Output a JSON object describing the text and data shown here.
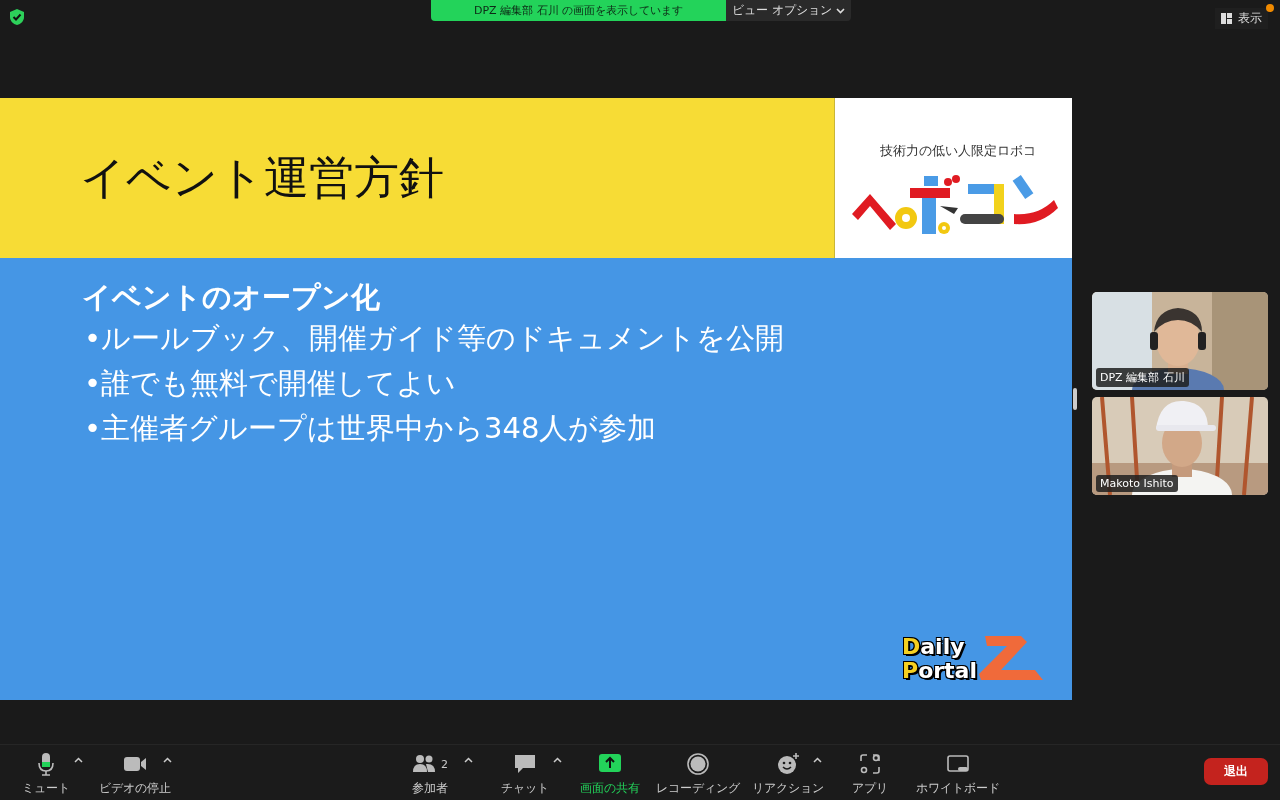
{
  "top_bar": {
    "share_banner": "DPZ 編集部 石川 の画面を表示しています",
    "view_options": "ビュー オプション",
    "view_button": "表示"
  },
  "slide": {
    "title": "イベント運営方針",
    "logo_caption": "技術力の低い人限定ロボコ",
    "heading": "イベントのオープン化",
    "bullets": [
      "•ルールブック、開催ガイド等のドキュメントを公開",
      "•誰でも無料で開催してよい",
      "•主催者グループは世界中から348人が参加"
    ],
    "brand": [
      "Daily",
      "Portal"
    ]
  },
  "videos": [
    {
      "name": "DPZ 編集部 石川",
      "kind": "picture"
    },
    {
      "name": "Makoto Ishito",
      "kind": "picture"
    }
  ],
  "toolbar": {
    "items": [
      {
        "kind": "mic",
        "label": "ミュート",
        "caret": true,
        "active": false
      },
      {
        "kind": "camera",
        "label": "ビデオの停止",
        "caret": true,
        "active": false
      },
      {
        "kind": "people",
        "label": "参加者",
        "count": "2",
        "caret": true,
        "active": false
      },
      {
        "kind": "chat",
        "label": "チャット",
        "caret": true,
        "active": false
      },
      {
        "kind": "share",
        "label": "画面の共有",
        "caret": false,
        "active": true
      },
      {
        "kind": "record",
        "label": "レコーディング",
        "caret": false,
        "active": false
      },
      {
        "kind": "reaction",
        "label": "リアクション",
        "caret": true,
        "active": false
      },
      {
        "kind": "apps",
        "label": "アプリ",
        "caret": false,
        "active": false
      },
      {
        "kind": "whiteboard",
        "label": "ホワイトボード",
        "caret": false,
        "active": false
      }
    ],
    "leave": "退出"
  }
}
